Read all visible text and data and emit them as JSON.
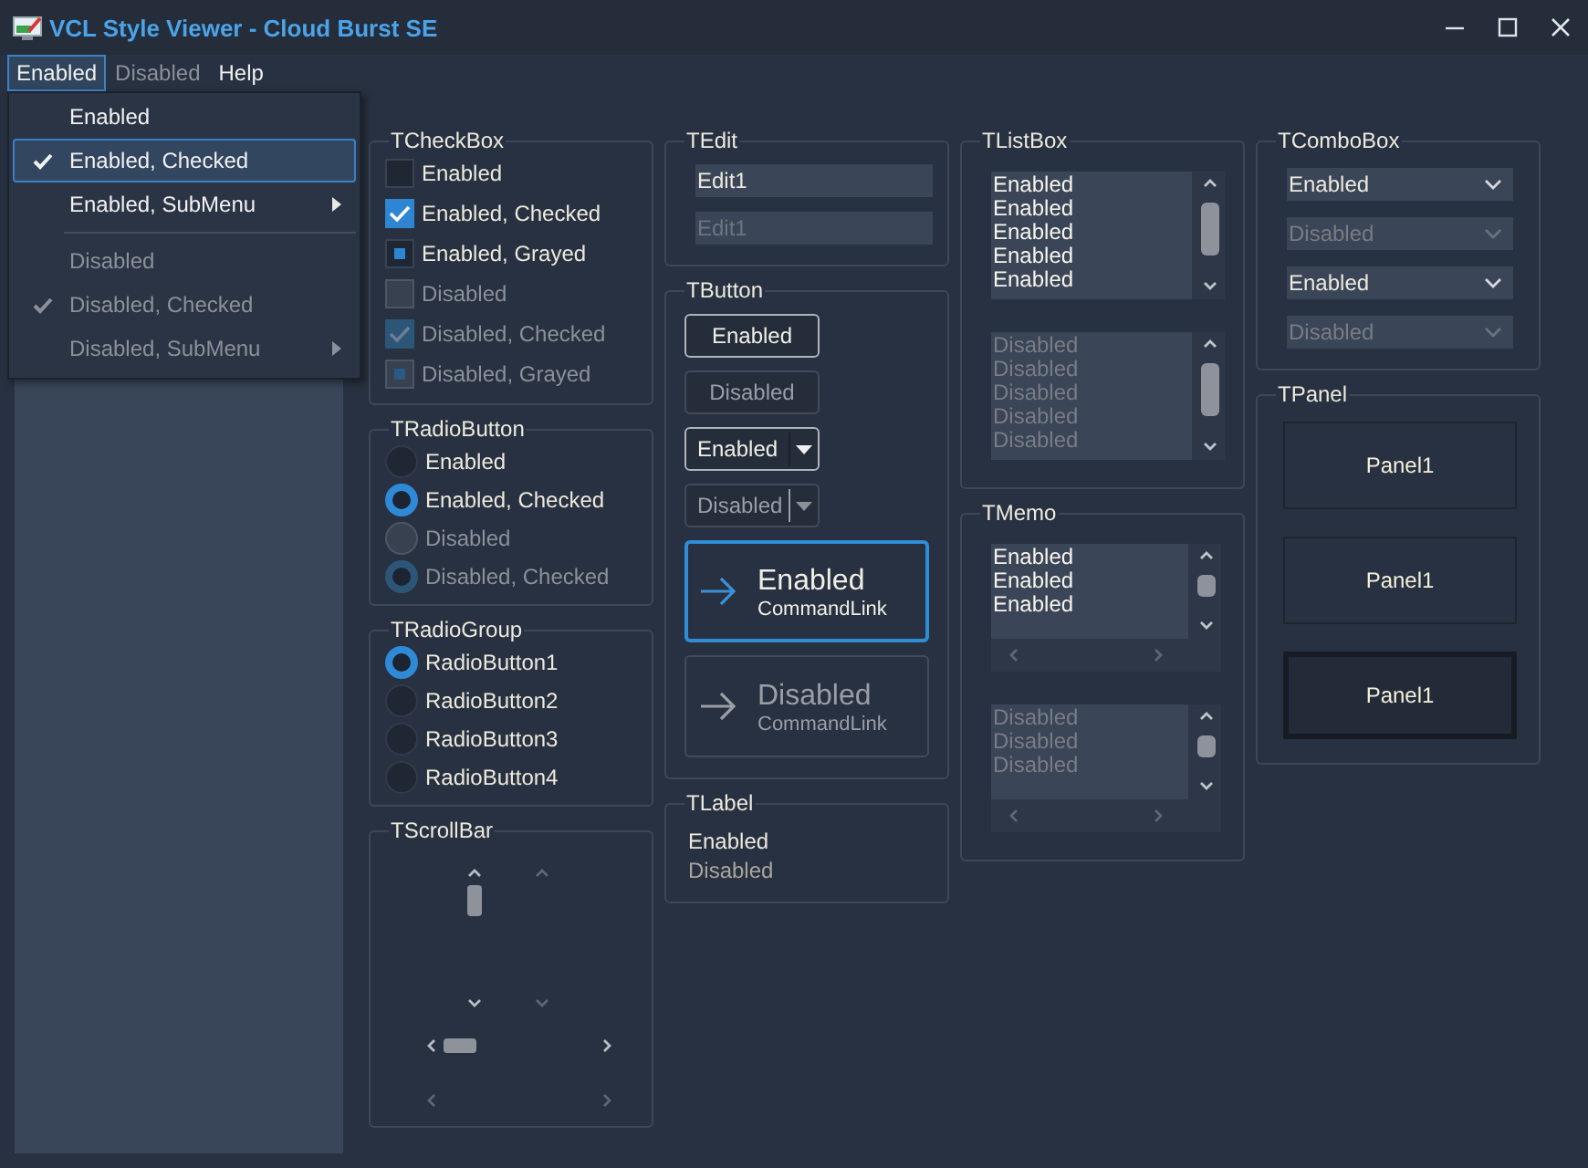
{
  "window": {
    "title": "VCL Style Viewer - Cloud Burst SE"
  },
  "menu_bar": [
    {
      "label": "Enabled",
      "selected": true,
      "disabled": false
    },
    {
      "label": "Disabled",
      "selected": false,
      "disabled": true
    },
    {
      "label": "Help",
      "selected": false,
      "disabled": false
    }
  ],
  "dropdown_menu": [
    {
      "kind": "item",
      "label": "Enabled",
      "checked": false,
      "disabled": false,
      "submenu": false,
      "selected": false
    },
    {
      "kind": "item",
      "label": "Enabled, Checked",
      "checked": true,
      "disabled": false,
      "submenu": false,
      "selected": true
    },
    {
      "kind": "item",
      "label": "Enabled, SubMenu",
      "checked": false,
      "disabled": false,
      "submenu": true,
      "selected": false
    },
    {
      "kind": "separator"
    },
    {
      "kind": "item",
      "label": "Disabled",
      "checked": false,
      "disabled": true,
      "submenu": false,
      "selected": false
    },
    {
      "kind": "item",
      "label": "Disabled, Checked",
      "checked": true,
      "disabled": true,
      "submenu": false,
      "selected": false
    },
    {
      "kind": "item",
      "label": "Disabled, SubMenu",
      "checked": false,
      "disabled": true,
      "submenu": true,
      "selected": false
    }
  ],
  "columns": [
    {
      "groups": [
        {
          "kind": "checkbox",
          "title": "TCheckBox",
          "items": [
            {
              "label": "Enabled",
              "checked": false,
              "grayed": false,
              "disabled": false
            },
            {
              "label": "Enabled, Checked",
              "checked": true,
              "grayed": false,
              "disabled": false
            },
            {
              "label": "Enabled, Grayed",
              "checked": false,
              "grayed": true,
              "disabled": false
            },
            {
              "label": "Disabled",
              "checked": false,
              "grayed": false,
              "disabled": true
            },
            {
              "label": "Disabled, Checked",
              "checked": true,
              "grayed": false,
              "disabled": true
            },
            {
              "label": "Disabled, Grayed",
              "checked": false,
              "grayed": true,
              "disabled": true
            }
          ]
        },
        {
          "kind": "radio",
          "title": "TRadioButton",
          "items": [
            {
              "label": "Enabled",
              "checked": false,
              "disabled": false
            },
            {
              "label": "Enabled, Checked",
              "checked": true,
              "disabled": false
            },
            {
              "label": "Disabled",
              "checked": false,
              "disabled": true
            },
            {
              "label": "Disabled, Checked",
              "checked": true,
              "disabled": true
            }
          ]
        },
        {
          "kind": "radio",
          "title": "TRadioGroup",
          "items": [
            {
              "label": "RadioButton1",
              "checked": true,
              "disabled": false
            },
            {
              "label": "RadioButton2",
              "checked": false,
              "disabled": false
            },
            {
              "label": "RadioButton3",
              "checked": false,
              "disabled": false
            },
            {
              "label": "RadioButton4",
              "checked": false,
              "disabled": false
            }
          ]
        },
        {
          "kind": "scrollbar",
          "title": "TScrollBar",
          "items": [
            {
              "kind": "vertical",
              "disabled": false
            },
            {
              "kind": "vertical",
              "disabled": true
            },
            {
              "kind": "horizontal",
              "disabled": false
            },
            {
              "kind": "horizontal",
              "disabled": true
            }
          ]
        }
      ]
    },
    {
      "groups": [
        {
          "kind": "edit",
          "title": "TEdit",
          "items": [
            {
              "value": "Edit1",
              "disabled": false
            },
            {
              "value": "Edit1",
              "disabled": true
            }
          ]
        },
        {
          "kind": "button",
          "title": "TButton",
          "items": [
            {
              "kind": "push",
              "label": "Enabled",
              "disabled": false
            },
            {
              "kind": "push",
              "label": "Disabled",
              "disabled": true
            },
            {
              "kind": "split",
              "label": "Enabled",
              "disabled": false
            },
            {
              "kind": "split",
              "label": "Disabled",
              "disabled": true
            },
            {
              "kind": "commandlink",
              "label": "Enabled",
              "note": "CommandLink",
              "disabled": false
            },
            {
              "kind": "commandlink",
              "label": "Disabled",
              "note": "CommandLink",
              "disabled": true
            }
          ]
        },
        {
          "kind": "label",
          "title": "TLabel",
          "items": [
            {
              "text": "Enabled",
              "disabled": false
            },
            {
              "text": "Disabled",
              "disabled": true
            }
          ]
        }
      ]
    },
    {
      "groups": [
        {
          "kind": "listbox",
          "title": "TListBox",
          "items": [
            {
              "disabled": false,
              "lines": [
                "Enabled",
                "Enabled",
                "Enabled",
                "Enabled",
                "Enabled"
              ]
            },
            {
              "disabled": true,
              "lines": [
                "Disabled",
                "Disabled",
                "Disabled",
                "Disabled",
                "Disabled"
              ]
            }
          ]
        },
        {
          "kind": "memo",
          "title": "TMemo",
          "items": [
            {
              "disabled": false,
              "lines": [
                "Enabled",
                "Enabled",
                "Enabled"
              ]
            },
            {
              "disabled": true,
              "lines": [
                "Disabled",
                "Disabled",
                "Disabled"
              ]
            }
          ]
        }
      ]
    },
    {
      "groups": [
        {
          "kind": "combobox",
          "title": "TComboBox",
          "items": [
            {
              "value": "Enabled",
              "disabled": false
            },
            {
              "value": "Disabled",
              "disabled": true
            },
            {
              "value": "Enabled",
              "disabled": false
            },
            {
              "value": "Disabled",
              "disabled": true
            }
          ]
        },
        {
          "kind": "panel",
          "title": "TPanel",
          "items": [
            {
              "label": "Panel1",
              "sunken": false
            },
            {
              "label": "Panel1",
              "sunken": false
            },
            {
              "label": "Panel1",
              "sunken": true
            }
          ]
        }
      ]
    }
  ]
}
